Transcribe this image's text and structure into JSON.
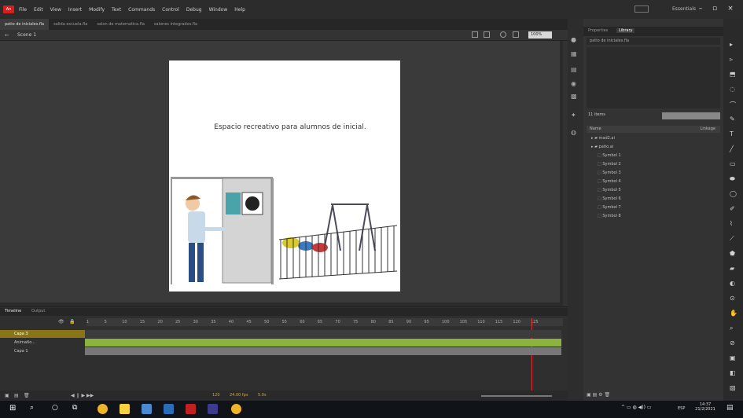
{
  "menubar": {
    "logo": "An",
    "items": [
      "File",
      "Edit",
      "View",
      "Insert",
      "Modify",
      "Text",
      "Commands",
      "Control",
      "Debug",
      "Window",
      "Help"
    ],
    "workspace": "Essentials"
  },
  "document_tabs": [
    "patio de iniciales.fla",
    "salida escuela.fla",
    "salon de matematica.fla",
    "salones integrados.fla"
  ],
  "scene": {
    "label": "Scene 1",
    "zoom": "100%"
  },
  "stage": {
    "text": "Espacio recreativo para alumnos de inicial.",
    "background": "#ffffff"
  },
  "timeline": {
    "tabs": [
      "Timeline",
      "Output"
    ],
    "frame_numbers": [
      "1",
      "5",
      "10",
      "15",
      "20",
      "25",
      "30",
      "35",
      "40",
      "45",
      "50",
      "55",
      "60",
      "65",
      "70",
      "75",
      "80",
      "85",
      "90",
      "95",
      "100",
      "105",
      "110",
      "115",
      "120",
      "125"
    ],
    "layers": [
      "Capa 3",
      "Animatio...",
      "Capa 1"
    ],
    "footer_fps": "24.00 fps",
    "footer_time": "5.0s",
    "footer_frame": "120"
  },
  "library": {
    "tabs": [
      "Properties",
      "Library"
    ],
    "document": "patio de iniciales.fla",
    "item_count": "11 items",
    "column_name": "Name",
    "column_linkage": "Linkage",
    "items": [
      "mad2.ai",
      "patio.ai",
      "Symbol 1",
      "Symbol 2",
      "Symbol 3",
      "Symbol 4",
      "Symbol 5",
      "Symbol 6",
      "Symbol 7",
      "Symbol 8"
    ]
  },
  "taskbar": {
    "time": "14:37",
    "date": "21/2/2021",
    "lang": "ESP"
  },
  "colors": {
    "accent": "#d61e1e",
    "frame_green": "#8bb33d",
    "layer_selected": "#8a7418"
  }
}
